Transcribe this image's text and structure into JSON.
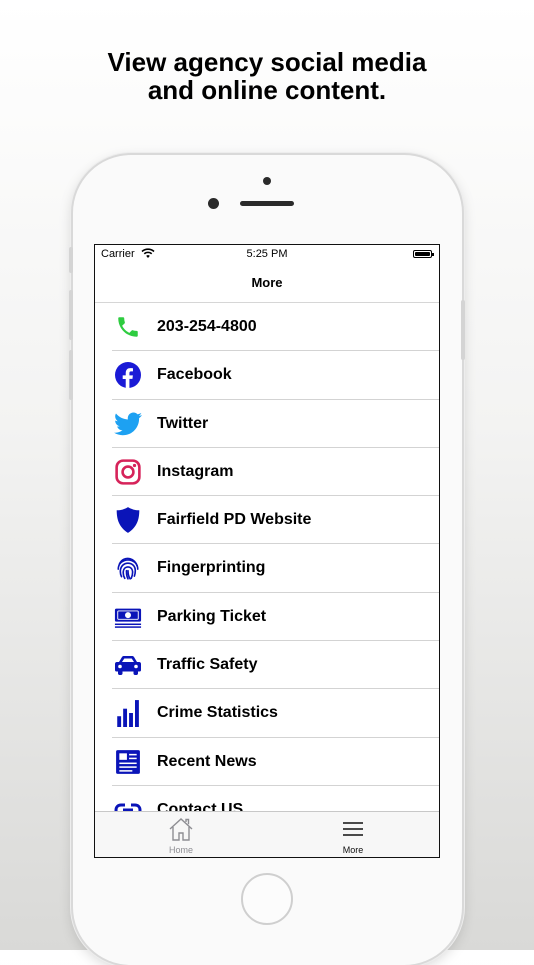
{
  "headline": {
    "line1": "View agency social media",
    "line2": "and online content."
  },
  "status_bar": {
    "carrier": "Carrier",
    "time": "5:25 PM",
    "icons": [
      "wifi-icon",
      "battery-icon"
    ]
  },
  "nav": {
    "title": "More"
  },
  "items": [
    {
      "label": "203-254-4800",
      "icon": "phone-icon",
      "color": "#2ecc40"
    },
    {
      "label": "Facebook",
      "icon": "facebook-icon",
      "color": "#1a1ad6"
    },
    {
      "label": "Twitter",
      "icon": "twitter-icon",
      "color": "#1da1f2"
    },
    {
      "label": "Instagram",
      "icon": "instagram-icon",
      "color": "#d6235a"
    },
    {
      "label": "Fairfield PD Website",
      "icon": "shield-icon",
      "color": "#0a14b8"
    },
    {
      "label": "Fingerprinting",
      "icon": "fingerprint-icon",
      "color": "#0a14b8"
    },
    {
      "label": "Parking Ticket",
      "icon": "money-icon",
      "color": "#0a14b8"
    },
    {
      "label": "Traffic Safety",
      "icon": "car-icon",
      "color": "#0a14b8"
    },
    {
      "label": "Crime Statistics",
      "icon": "bar-chart-icon",
      "color": "#0a14b8"
    },
    {
      "label": "Recent News",
      "icon": "newspaper-icon",
      "color": "#0a14b8"
    },
    {
      "label": "Contact US",
      "icon": "link-icon",
      "color": "#0a14b8"
    }
  ],
  "tabs": [
    {
      "label": "Home",
      "icon": "home-icon",
      "color": "#8e8e93"
    },
    {
      "label": "More",
      "icon": "menu-icon",
      "color": "#111111"
    }
  ]
}
